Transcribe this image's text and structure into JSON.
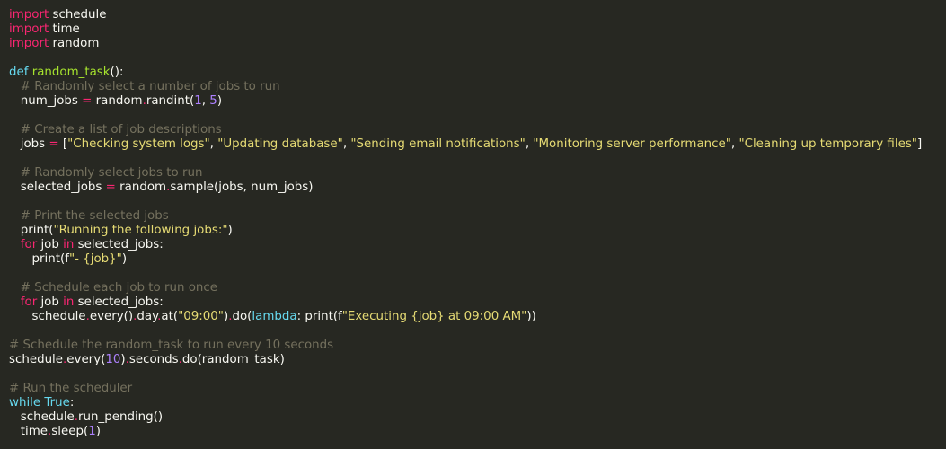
{
  "editor": {
    "theme_colors": {
      "background": "#272822",
      "text": "#f8f8f2",
      "keyword": "#f92672",
      "builtin": "#66d9ef",
      "function": "#a6e22e",
      "string": "#e6db74",
      "number": "#ae81ff",
      "comment": "#75715e"
    },
    "lines": [
      [
        [
          "kw",
          "import"
        ],
        [
          "t",
          " schedule"
        ]
      ],
      [
        [
          "kw",
          "import"
        ],
        [
          "t",
          " time"
        ]
      ],
      [
        [
          "kw",
          "import"
        ],
        [
          "t",
          " random"
        ]
      ],
      [],
      [
        [
          "def",
          "def"
        ],
        [
          "t",
          " "
        ],
        [
          "fn",
          "random_task"
        ],
        [
          "t",
          "():"
        ]
      ],
      [
        [
          "t",
          "   "
        ],
        [
          "cm",
          "# Randomly select a number of jobs to run"
        ]
      ],
      [
        [
          "t",
          "   num_jobs "
        ],
        [
          "op",
          "="
        ],
        [
          "t",
          " random"
        ],
        [
          "dot",
          "."
        ],
        [
          "t",
          "randint("
        ],
        [
          "num",
          "1"
        ],
        [
          "t",
          ", "
        ],
        [
          "num",
          "5"
        ],
        [
          "t",
          ")"
        ]
      ],
      [],
      [
        [
          "t",
          "   "
        ],
        [
          "cm",
          "# Create a list of job descriptions"
        ]
      ],
      [
        [
          "t",
          "   jobs "
        ],
        [
          "op",
          "="
        ],
        [
          "t",
          " ["
        ],
        [
          "str",
          "\"Checking system logs\""
        ],
        [
          "t",
          ", "
        ],
        [
          "str",
          "\"Updating database\""
        ],
        [
          "t",
          ", "
        ],
        [
          "str",
          "\"Sending email notifications\""
        ],
        [
          "t",
          ", "
        ],
        [
          "str",
          "\"Monitoring server performance\""
        ],
        [
          "t",
          ", "
        ],
        [
          "str",
          "\"Cleaning up temporary files\""
        ],
        [
          "t",
          "]"
        ]
      ],
      [],
      [
        [
          "t",
          "   "
        ],
        [
          "cm",
          "# Randomly select jobs to run"
        ]
      ],
      [
        [
          "t",
          "   selected_jobs "
        ],
        [
          "op",
          "="
        ],
        [
          "t",
          " random"
        ],
        [
          "dot",
          "."
        ],
        [
          "t",
          "sample(jobs, num_jobs)"
        ]
      ],
      [],
      [
        [
          "t",
          "   "
        ],
        [
          "cm",
          "# Print the selected jobs"
        ]
      ],
      [
        [
          "t",
          "   print("
        ],
        [
          "str",
          "\"Running the following jobs:\""
        ],
        [
          "t",
          ")"
        ]
      ],
      [
        [
          "t",
          "   "
        ],
        [
          "kw",
          "for"
        ],
        [
          "t",
          " job "
        ],
        [
          "kw",
          "in"
        ],
        [
          "t",
          " selected_jobs:"
        ]
      ],
      [
        [
          "t",
          "      print(f"
        ],
        [
          "str",
          "\"- {job}\""
        ],
        [
          "t",
          ")"
        ]
      ],
      [],
      [
        [
          "t",
          "   "
        ],
        [
          "cm",
          "# Schedule each job to run once"
        ]
      ],
      [
        [
          "t",
          "   "
        ],
        [
          "kw",
          "for"
        ],
        [
          "t",
          " job "
        ],
        [
          "kw",
          "in"
        ],
        [
          "t",
          " selected_jobs:"
        ]
      ],
      [
        [
          "t",
          "      schedule"
        ],
        [
          "dot",
          "."
        ],
        [
          "t",
          "every()"
        ],
        [
          "dot",
          "."
        ],
        [
          "t",
          "day"
        ],
        [
          "dot",
          "."
        ],
        [
          "t",
          "at("
        ],
        [
          "str",
          "\"09:00\""
        ],
        [
          "t",
          ")"
        ],
        [
          "dot",
          "."
        ],
        [
          "t",
          "do("
        ],
        [
          "def",
          "lambda"
        ],
        [
          "t",
          ": print(f"
        ],
        [
          "str",
          "\"Executing {job} at 09:00 AM\""
        ],
        [
          "t",
          "))"
        ]
      ],
      [],
      [
        [
          "cm",
          "# Schedule the random_task to run every 10 seconds"
        ]
      ],
      [
        [
          "t",
          "schedule"
        ],
        [
          "dot",
          "."
        ],
        [
          "t",
          "every("
        ],
        [
          "num",
          "10"
        ],
        [
          "t",
          ")"
        ],
        [
          "dot",
          "."
        ],
        [
          "t",
          "seconds"
        ],
        [
          "dot",
          "."
        ],
        [
          "t",
          "do(random_task)"
        ]
      ],
      [],
      [
        [
          "cm",
          "# Run the scheduler"
        ]
      ],
      [
        [
          "def",
          "while"
        ],
        [
          "t",
          " "
        ],
        [
          "def",
          "True"
        ],
        [
          "t",
          ":"
        ]
      ],
      [
        [
          "t",
          "   schedule"
        ],
        [
          "dot",
          "."
        ],
        [
          "t",
          "run_pending()"
        ]
      ],
      [
        [
          "t",
          "   time"
        ],
        [
          "dot",
          "."
        ],
        [
          "t",
          "sleep("
        ],
        [
          "num",
          "1"
        ],
        [
          "t",
          ")"
        ]
      ]
    ]
  }
}
